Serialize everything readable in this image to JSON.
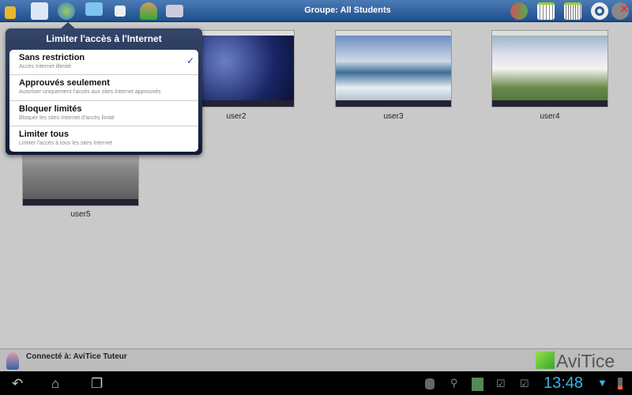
{
  "topbar": {
    "title": "Groupe: All Students",
    "left_icons": [
      "lock-icon",
      "window-icon",
      "globe-icon",
      "monitor-icon",
      "message-icon",
      "user-transfer-icon",
      "printer-icon"
    ],
    "right_icons": [
      "users-icon",
      "grid-view-icon",
      "list-view-icon",
      "gear-icon",
      "disconnect-icon"
    ]
  },
  "popup": {
    "title": "Limiter l'accès à l'Internet",
    "items": [
      {
        "label": "Sans restriction",
        "sub": "Accès Internet illimité",
        "checked": true
      },
      {
        "label": "Approuvés seulement",
        "sub": "Autoriser uniquement l'accès aux sites Internet approuvés",
        "checked": false
      },
      {
        "label": "Bloquer limités",
        "sub": "Bloquer les sites Internet d'accès limité",
        "checked": false
      },
      {
        "label": "Limiter tous",
        "sub": "Limiter l'accès à tous les sites Internet",
        "checked": false
      }
    ],
    "check": "✓"
  },
  "students": [
    {
      "name": "user2"
    },
    {
      "name": "user3"
    },
    {
      "name": "user4"
    },
    {
      "name": "user5"
    }
  ],
  "status": {
    "text": "Connecté à: AviTice Tuteur",
    "brand": "AviTice"
  },
  "systembar": {
    "time": "13:48"
  }
}
